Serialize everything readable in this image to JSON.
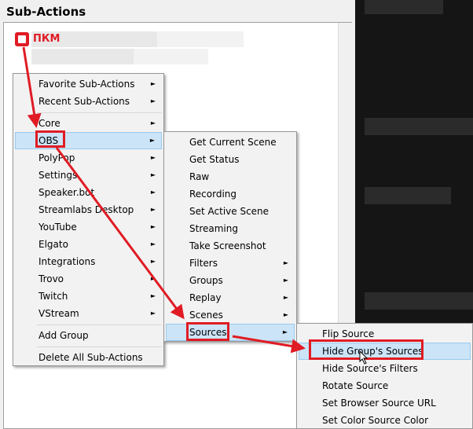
{
  "panel": {
    "title": "Sub-Actions"
  },
  "annotation": {
    "pkm_label": "ПКМ"
  },
  "menu1": {
    "items": [
      {
        "label": "Favorite Sub-Actions",
        "arrow": "►"
      },
      {
        "label": "Recent Sub-Actions",
        "arrow": "►"
      },
      {
        "label": "Core",
        "arrow": "►"
      },
      {
        "label": "OBS",
        "arrow": "►"
      },
      {
        "label": "PolyPop",
        "arrow": "►"
      },
      {
        "label": "Settings",
        "arrow": "►"
      },
      {
        "label": "Speaker.bot",
        "arrow": "►"
      },
      {
        "label": "Streamlabs Desktop",
        "arrow": "►"
      },
      {
        "label": "YouTube",
        "arrow": "►"
      },
      {
        "label": "Elgato",
        "arrow": "►"
      },
      {
        "label": "Integrations",
        "arrow": "►"
      },
      {
        "label": "Trovo",
        "arrow": "►"
      },
      {
        "label": "Twitch",
        "arrow": "►"
      },
      {
        "label": "VStream",
        "arrow": "►"
      },
      {
        "label": "Add Group"
      },
      {
        "label": "Delete All Sub-Actions"
      }
    ]
  },
  "menu2": {
    "items": [
      {
        "label": "Get Current Scene"
      },
      {
        "label": "Get Status"
      },
      {
        "label": "Raw"
      },
      {
        "label": "Recording"
      },
      {
        "label": "Set Active Scene"
      },
      {
        "label": "Streaming"
      },
      {
        "label": "Take Screenshot"
      },
      {
        "label": "Filters",
        "arrow": "►"
      },
      {
        "label": "Groups",
        "arrow": "►"
      },
      {
        "label": "Replay",
        "arrow": "►"
      },
      {
        "label": "Scenes",
        "arrow": "►"
      },
      {
        "label": "Sources",
        "arrow": "►"
      }
    ]
  },
  "menu3": {
    "items": [
      {
        "label": "Flip Source"
      },
      {
        "label": "Hide Group's Sources"
      },
      {
        "label": "Hide Source's Filters"
      },
      {
        "label": "Rotate Source"
      },
      {
        "label": "Set Browser Source URL"
      },
      {
        "label": "Set Color Source Color"
      }
    ]
  },
  "colors": {
    "highlight": "#cce4f7",
    "annotation": "#e01b24"
  }
}
